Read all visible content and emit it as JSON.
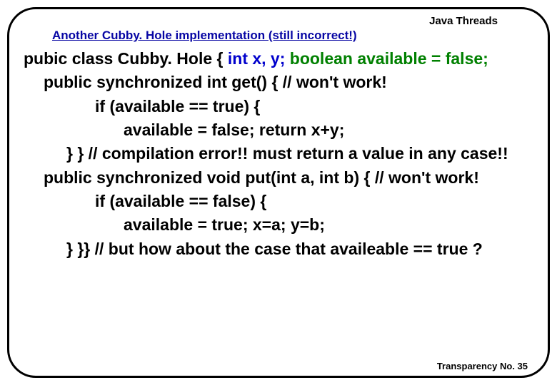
{
  "header": {
    "title": "Java Threads"
  },
  "subtitle": "Another Cubby. Hole implementation (still incorrect!)",
  "code": {
    "l1a": "pubic class Cubby. Hole {  ",
    "l1b": "int x, y;  ",
    "l1c": "boolean available = false;",
    "l2": "public synchronized int get() {    // won't work!",
    "l3": "if (available == true) {",
    "l4": "available = false;   return x+y;",
    "l5": "}  }   // compilation error!! must return a value in any case!!",
    "l6": "public synchronized void put(int a, int b) {    // won't work!",
    "l7": "if (available == false) {",
    "l8": "available = true;     x=a; y=b;",
    "l9": "} }} // but how about the case that availeable == true ?"
  },
  "footer": {
    "text": "Transparency No. 35"
  }
}
